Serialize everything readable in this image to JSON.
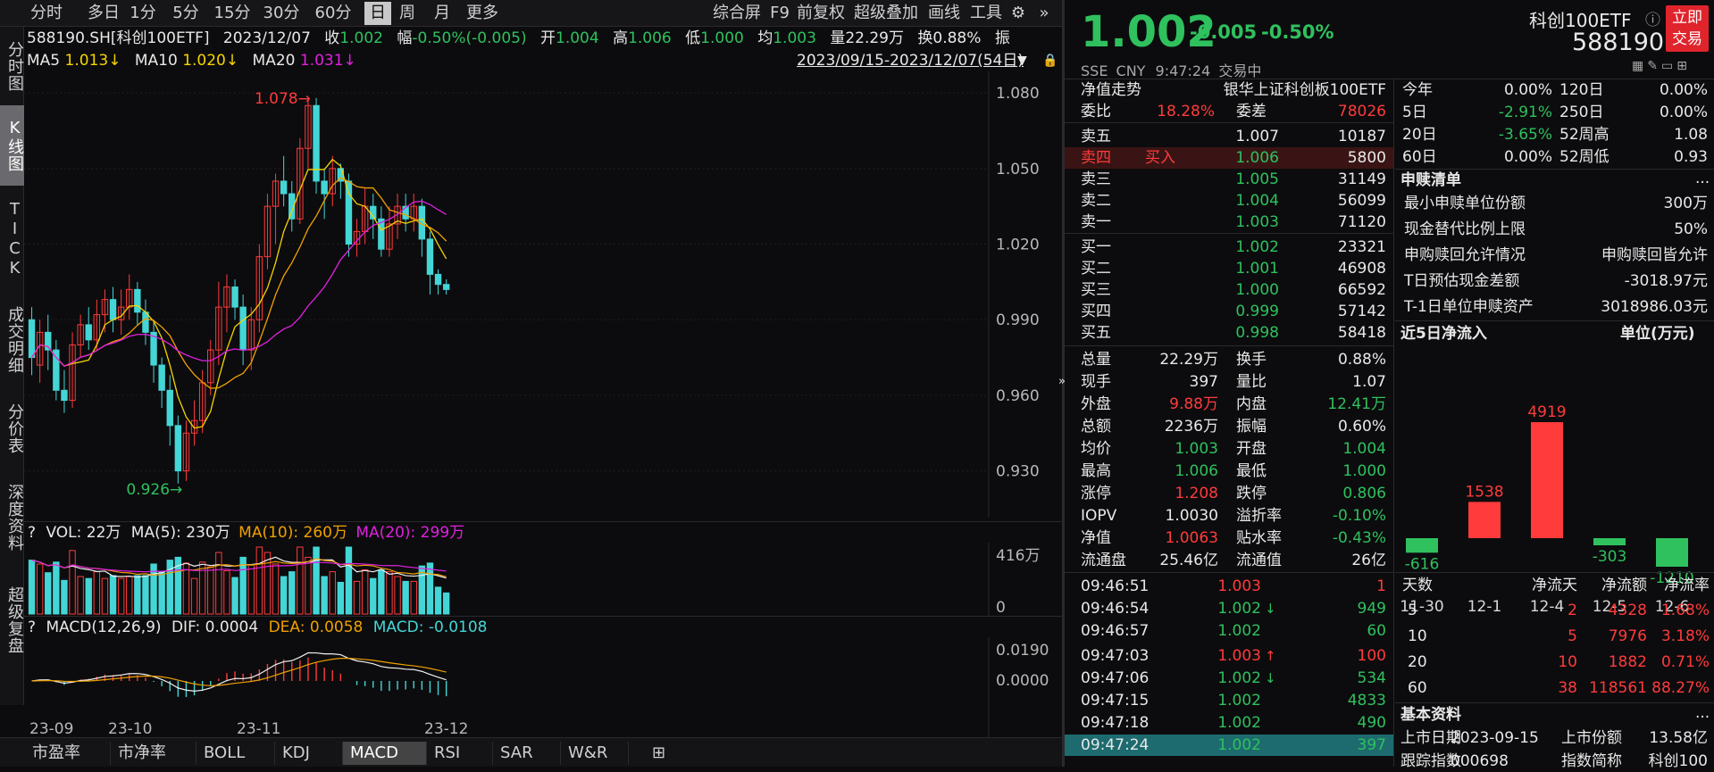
{
  "toolbar": {
    "tabs": [
      "分时",
      "多日",
      "1分",
      "5分",
      "15分",
      "30分",
      "60分",
      "日",
      "周",
      "月",
      "更多"
    ],
    "active": "日",
    "right": [
      "综合屏",
      "F9",
      "前复权",
      "超级叠加",
      "画线",
      "工具"
    ]
  },
  "vnav": [
    "分时图",
    "K线图",
    "TICK",
    "成交明细",
    "分价表",
    "深度资料",
    "超级复盘"
  ],
  "info": {
    "code": "588190.SH[科创100ETF]",
    "date": "2023/12/07",
    "close_label": "收",
    "close": "1.002",
    "chg_label": "幅",
    "chg": "-0.50%(-0.005)",
    "open_label": "开",
    "open": "1.004",
    "high_label": "高",
    "high": "1.006",
    "low_label": "低",
    "low": "1.000",
    "avg_label": "均",
    "avg": "1.003",
    "vol_label": "量",
    "vol": "22.29万",
    "turn_label": "换",
    "turn": "0.88%",
    "amp_label": "振"
  },
  "ma": {
    "ma5_label": "MA5",
    "ma5": "1.013↓",
    "ma10_label": "MA10",
    "ma10": "1.020↓",
    "ma20_label": "MA20",
    "ma20": "1.031↓",
    "range": "2023/09/15-2023/12/07(54日)"
  },
  "chart_data": {
    "type": "candlestick",
    "ylim": [
      0.915,
      1.085
    ],
    "yticks": [
      "1.080",
      "1.050",
      "1.020",
      "0.990",
      "0.960",
      "0.930"
    ],
    "high_label": "1.078",
    "low_label": "0.926",
    "xticks": [
      "23-09",
      "23-10",
      "23-11",
      "23-12"
    ],
    "candles": [
      [
        0.99,
        0.975,
        0.995,
        0.968
      ],
      [
        0.972,
        0.985,
        0.99,
        0.965
      ],
      [
        0.985,
        0.978,
        0.992,
        0.97
      ],
      [
        0.978,
        0.962,
        0.982,
        0.958
      ],
      [
        0.962,
        0.958,
        0.97,
        0.953
      ],
      [
        0.958,
        0.98,
        0.985,
        0.955
      ],
      [
        0.98,
        0.988,
        0.992,
        0.975
      ],
      [
        0.988,
        0.982,
        0.995,
        0.978
      ],
      [
        0.982,
        0.992,
        0.998,
        0.978
      ],
      [
        0.992,
        0.998,
        1.002,
        0.985
      ],
      [
        0.998,
        0.99,
        1.003,
        0.985
      ],
      [
        0.99,
        0.995,
        1.002,
        0.984
      ],
      [
        0.995,
        1.002,
        1.008,
        0.99
      ],
      [
        1.002,
        0.993,
        1.005,
        0.988
      ],
      [
        0.993,
        0.985,
        0.998,
        0.98
      ],
      [
        0.985,
        0.972,
        0.99,
        0.965
      ],
      [
        0.972,
        0.962,
        0.975,
        0.955
      ],
      [
        0.962,
        0.948,
        0.968,
        0.94
      ],
      [
        0.948,
        0.93,
        0.952,
        0.925
      ],
      [
        0.93,
        0.945,
        0.95,
        0.926
      ],
      [
        0.945,
        0.95,
        0.958,
        0.94
      ],
      [
        0.95,
        0.965,
        0.97,
        0.945
      ],
      [
        0.965,
        0.978,
        0.982,
        0.96
      ],
      [
        0.978,
        0.995,
        1.005,
        0.972
      ],
      [
        0.995,
        1.003,
        1.008,
        0.985
      ],
      [
        1.003,
        0.995,
        1.006,
        0.99
      ],
      [
        0.995,
        0.978,
        1.0,
        0.972
      ],
      [
        0.978,
        0.99,
        0.995,
        0.97
      ],
      [
        0.99,
        1.015,
        1.02,
        0.985
      ],
      [
        1.015,
        1.035,
        1.04,
        1.01
      ],
      [
        1.035,
        1.045,
        1.048,
        1.02
      ],
      [
        1.045,
        1.04,
        1.055,
        1.035
      ],
      [
        1.04,
        1.03,
        1.045,
        1.025
      ],
      [
        1.03,
        1.058,
        1.062,
        1.028
      ],
      [
        1.058,
        1.075,
        1.078,
        1.05
      ],
      [
        1.075,
        1.045,
        1.078,
        1.04
      ],
      [
        1.045,
        1.04,
        1.05,
        1.03
      ],
      [
        1.04,
        1.05,
        1.055,
        1.035
      ],
      [
        1.05,
        1.045,
        1.052,
        1.038
      ],
      [
        1.045,
        1.02,
        1.048,
        1.015
      ],
      [
        1.02,
        1.025,
        1.03,
        1.015
      ],
      [
        1.025,
        1.035,
        1.042,
        1.02
      ],
      [
        1.035,
        1.03,
        1.04,
        1.022
      ],
      [
        1.03,
        1.018,
        1.035,
        1.015
      ],
      [
        1.018,
        1.028,
        1.035,
        1.015
      ],
      [
        1.028,
        1.035,
        1.04,
        1.022
      ],
      [
        1.035,
        1.03,
        1.04,
        1.025
      ],
      [
        1.03,
        1.035,
        1.04,
        1.025
      ],
      [
        1.035,
        1.022,
        1.038,
        1.015
      ],
      [
        1.022,
        1.008,
        1.025,
        1.0
      ],
      [
        1.008,
        1.004,
        1.01,
        1.0
      ],
      [
        1.004,
        1.002,
        1.006,
        1.0
      ]
    ],
    "volume": {
      "label": "VOL: 22万",
      "ma5": "MA(5): 230万",
      "ma10": "MA(10): 260万",
      "ma20": "MA(20): 299万",
      "yticks": [
        "416万",
        "0"
      ]
    },
    "macd": {
      "label": "MACD(12,26,9)",
      "dif": "DIF: 0.0004",
      "dea": "DEA: 0.0058",
      "macd": "MACD: -0.0108",
      "yticks": [
        "0.0190",
        "0.0000"
      ]
    }
  },
  "bottom_tabs": [
    "市盈率",
    "市净率",
    "BOLL",
    "KDJ",
    "MACD",
    "RSI",
    "SAR",
    "W&R"
  ],
  "quote": {
    "price": "1.002",
    "chg": "-0.005",
    "pct": "-0.50%",
    "name": "科创100ETF",
    "code": "588190",
    "btn": "立即交易",
    "exchange": "SSE",
    "currency": "CNY",
    "time": "9:47:24",
    "status": "交易中"
  },
  "nav": {
    "title": "净值走势",
    "name": "银华上证科创板100ETF"
  },
  "ratio": {
    "wb_label": "委比",
    "wb": "18.28%",
    "wc_label": "委差",
    "wc": "78026"
  },
  "asks": [
    {
      "l": "卖五",
      "p": "1.007",
      "v": "10187",
      "c": "white"
    },
    {
      "l": "卖四",
      "tag": "买入",
      "p": "1.006",
      "v": "5800",
      "c": "green"
    },
    {
      "l": "卖三",
      "p": "1.005",
      "v": "31149",
      "c": "green"
    },
    {
      "l": "卖二",
      "p": "1.004",
      "v": "56099",
      "c": "green"
    },
    {
      "l": "卖一",
      "p": "1.003",
      "v": "71120",
      "c": "green"
    }
  ],
  "bids": [
    {
      "l": "买一",
      "p": "1.002",
      "v": "23321"
    },
    {
      "l": "买二",
      "p": "1.001",
      "v": "46908"
    },
    {
      "l": "买三",
      "p": "1.000",
      "v": "66592"
    },
    {
      "l": "买四",
      "p": "0.999",
      "v": "57142"
    },
    {
      "l": "买五",
      "p": "0.998",
      "v": "58418"
    }
  ],
  "stats": [
    [
      {
        "l": "总量",
        "v": "22.29万",
        "c": "white"
      },
      {
        "l": "换手",
        "v": "0.88%",
        "c": "white"
      }
    ],
    [
      {
        "l": "现手",
        "v": "397",
        "c": "white"
      },
      {
        "l": "量比",
        "v": "1.07",
        "c": "white"
      }
    ],
    [
      {
        "l": "外盘",
        "v": "9.88万",
        "c": "red"
      },
      {
        "l": "内盘",
        "v": "12.41万",
        "c": "green"
      }
    ],
    [
      {
        "l": "总额",
        "v": "2236万",
        "c": "white"
      },
      {
        "l": "振幅",
        "v": "0.60%",
        "c": "white"
      }
    ],
    [
      {
        "l": "均价",
        "v": "1.003",
        "c": "green"
      },
      {
        "l": "开盘",
        "v": "1.004",
        "c": "green"
      }
    ],
    [
      {
        "l": "最高",
        "v": "1.006",
        "c": "green"
      },
      {
        "l": "最低",
        "v": "1.000",
        "c": "green"
      }
    ],
    [
      {
        "l": "涨停",
        "v": "1.208",
        "c": "red"
      },
      {
        "l": "跌停",
        "v": "0.806",
        "c": "green"
      }
    ],
    [
      {
        "l": "IOPV",
        "v": "1.0030",
        "c": "white"
      },
      {
        "l": "溢折率",
        "v": "-0.10%",
        "c": "green"
      }
    ],
    [
      {
        "l": "净值",
        "v": "1.0063",
        "c": "red"
      },
      {
        "l": "贴水率",
        "v": "-0.43%",
        "c": "green"
      }
    ],
    [
      {
        "l": "流通盘",
        "v": "25.46亿",
        "c": "white"
      },
      {
        "l": "流通值",
        "v": "26亿",
        "c": "white"
      }
    ]
  ],
  "ticks": [
    {
      "t": "09:46:51",
      "p": "1.003",
      "a": "",
      "v": "1",
      "c": "red"
    },
    {
      "t": "09:46:54",
      "p": "1.002",
      "a": "down",
      "v": "949",
      "c": "green"
    },
    {
      "t": "09:46:57",
      "p": "1.002",
      "a": "",
      "v": "60",
      "c": "green"
    },
    {
      "t": "09:47:03",
      "p": "1.003",
      "a": "up",
      "v": "100",
      "c": "red"
    },
    {
      "t": "09:47:06",
      "p": "1.002",
      "a": "down",
      "v": "534",
      "c": "green"
    },
    {
      "t": "09:47:15",
      "p": "1.002",
      "a": "",
      "v": "4833",
      "c": "green"
    },
    {
      "t": "09:47:18",
      "p": "1.002",
      "a": "",
      "v": "490",
      "c": "green"
    },
    {
      "t": "09:47:24",
      "p": "1.002",
      "a": "",
      "v": "397",
      "c": "green"
    }
  ],
  "perf": [
    [
      {
        "l": "今年",
        "v": "0.00%",
        "c": "white"
      },
      {
        "l": "120日",
        "v": "0.00%",
        "c": "white"
      }
    ],
    [
      {
        "l": "5日",
        "v": "-2.91%",
        "c": "green"
      },
      {
        "l": "250日",
        "v": "0.00%",
        "c": "white"
      }
    ],
    [
      {
        "l": "20日",
        "v": "-3.65%",
        "c": "green"
      },
      {
        "l": "52周高",
        "v": "1.08",
        "c": "white"
      }
    ],
    [
      {
        "l": "60日",
        "v": "0.00%",
        "c": "white"
      },
      {
        "l": "52周低",
        "v": "0.93",
        "c": "white"
      }
    ]
  ],
  "sg": {
    "title": "申赎清单",
    "more": "...",
    "rows": [
      {
        "l": "最小申赎单位份额",
        "v": "300万"
      },
      {
        "l": "现金替代比例上限",
        "v": "50%"
      },
      {
        "l": "申购赎回允许情况",
        "v": "申购赎回皆允许"
      },
      {
        "l": "T日预估现金差额",
        "v": "-3018.97元"
      },
      {
        "l": "T-1日单位申赎资产",
        "v": "3018986.03元"
      }
    ]
  },
  "flow": {
    "title": "近5日净流入",
    "unit": "单位(万元)",
    "days": [
      "11-30",
      "12-1",
      "12-4",
      "12-5",
      "12-6"
    ],
    "values": [
      -616,
      1538,
      4919,
      -303,
      -1210
    ],
    "labels": [
      "-616",
      "1538",
      "4919",
      "-303",
      "-1210"
    ]
  },
  "flowtable": {
    "headers": [
      "天数",
      "净流天",
      "净流额",
      "净流率"
    ],
    "rows": [
      [
        "5",
        "2",
        "4328",
        "1.68%"
      ],
      [
        "10",
        "5",
        "7976",
        "3.18%"
      ],
      [
        "20",
        "10",
        "1882",
        "0.71%"
      ],
      [
        "60",
        "38",
        "118561",
        "88.27%"
      ]
    ]
  },
  "basic": {
    "title": "基本资料",
    "more": "...",
    "r1": [
      {
        "l": "上市日期",
        "v": "2023-09-15"
      },
      {
        "l": "上市份额",
        "v": "13.58亿"
      }
    ],
    "r2": [
      {
        "l": "跟踪指数",
        "v": "000698"
      },
      {
        "l": "指数简称",
        "v": "科创100"
      }
    ]
  },
  "colors": {
    "up": "#ff3b3b",
    "down": "#2fc15e",
    "cyan": "#44d6d6",
    "yellow": "#f5d400",
    "orange": "#f0a000",
    "magenta": "#e020e0"
  }
}
